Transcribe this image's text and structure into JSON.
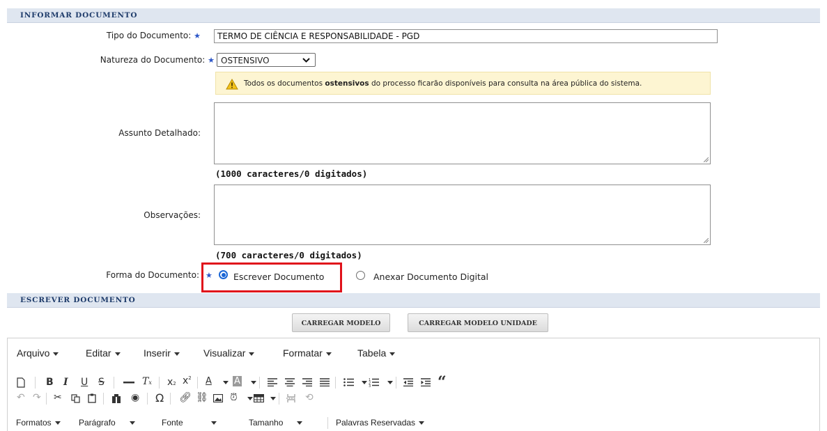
{
  "sections": {
    "informar": "Informar Documento",
    "escrever": "Escrever Documento"
  },
  "form": {
    "tipo": {
      "label": "Tipo do Documento:",
      "value": "TERMO DE CIÊNCIA E RESPONSABILIDADE - PGD"
    },
    "natureza": {
      "label": "Natureza do Documento:",
      "value": "OSTENSIVO"
    },
    "warning": {
      "prefix": "Todos os documentos ",
      "bold": "ostensivos",
      "suffix": " do processo ficarão disponíveis para consulta na área pública do sistema."
    },
    "assunto": {
      "label": "Assunto Detalhado:",
      "counter": "(1000 caracteres/0 digitados)"
    },
    "observacoes": {
      "label": "Observações:",
      "counter": "(700 caracteres/0 digitados)"
    },
    "forma": {
      "label": "Forma do Documento:",
      "option_escrever": "Escrever Documento",
      "option_anexar": "Anexar Documento Digital",
      "selected": "Escrever Documento"
    },
    "required_marker": "★"
  },
  "buttons": {
    "carregar_modelo": "CARREGAR MODELO",
    "carregar_modelo_unidade": "CARREGAR MODELO UNIDADE"
  },
  "editor": {
    "menus": [
      "Arquivo",
      "Editar",
      "Inserir",
      "Visualizar",
      "Formatar",
      "Tabela"
    ],
    "dropdowns": [
      "Formatos",
      "Parágrafo",
      "Fonte",
      "Tamanho",
      "Palavras Reservadas"
    ],
    "toolbar_icons": [
      "new-document-icon",
      "bold-icon",
      "italic-icon",
      "underline-icon",
      "strikethrough-icon",
      "horizontal-rule-icon",
      "clear-format-icon",
      "subscript-icon",
      "superscript-icon",
      "text-color-icon",
      "background-color-icon",
      "align-left-icon",
      "align-center-icon",
      "align-right-icon",
      "align-justify-icon",
      "bullet-list-icon",
      "numbered-list-icon",
      "outdent-icon",
      "indent-icon",
      "blockquote-icon",
      "undo-icon",
      "redo-icon",
      "cut-icon",
      "copy-icon",
      "paste-icon",
      "find-replace-icon",
      "preview-icon",
      "special-char-icon",
      "link-icon",
      "unlink-icon",
      "image-icon",
      "datetime-icon",
      "table-icon",
      "page-break-icon",
      "restore-draft-icon"
    ]
  },
  "colors": {
    "highlight_border": "#e0121b",
    "section_bg": "#dfe6f0",
    "section_text": "#1f3c6b",
    "radio_accent": "#1a66d6"
  }
}
